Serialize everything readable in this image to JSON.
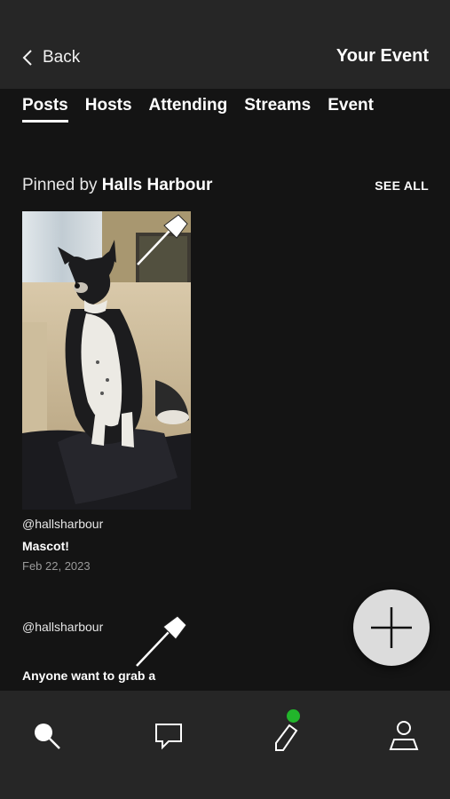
{
  "header": {
    "back_label": "Back",
    "title": "Your Event"
  },
  "tabs": [
    {
      "label": "Posts",
      "active": true
    },
    {
      "label": "Hosts",
      "active": false
    },
    {
      "label": "Attending",
      "active": false
    },
    {
      "label": "Streams",
      "active": false
    },
    {
      "label": "Event",
      "active": false
    }
  ],
  "pinned": {
    "prefix": "Pinned by ",
    "host": "Halls Harbour",
    "see_all": "SEE ALL"
  },
  "posts": [
    {
      "username": "@hallsharbour",
      "title": "Mascot!",
      "date": "Feb 22, 2023",
      "image": "dog-on-couch-photo"
    },
    {
      "username": "@hallsharbour",
      "title": "Anyone want to grab a"
    }
  ],
  "bottom_nav": [
    {
      "name": "search-icon"
    },
    {
      "name": "chat-icon"
    },
    {
      "name": "pencil-icon",
      "notification": true
    },
    {
      "name": "profile-icon"
    }
  ],
  "colors": {
    "background": "#141414",
    "bar": "#262626",
    "fab": "#dcdcdc",
    "notification": "#22b52b"
  }
}
